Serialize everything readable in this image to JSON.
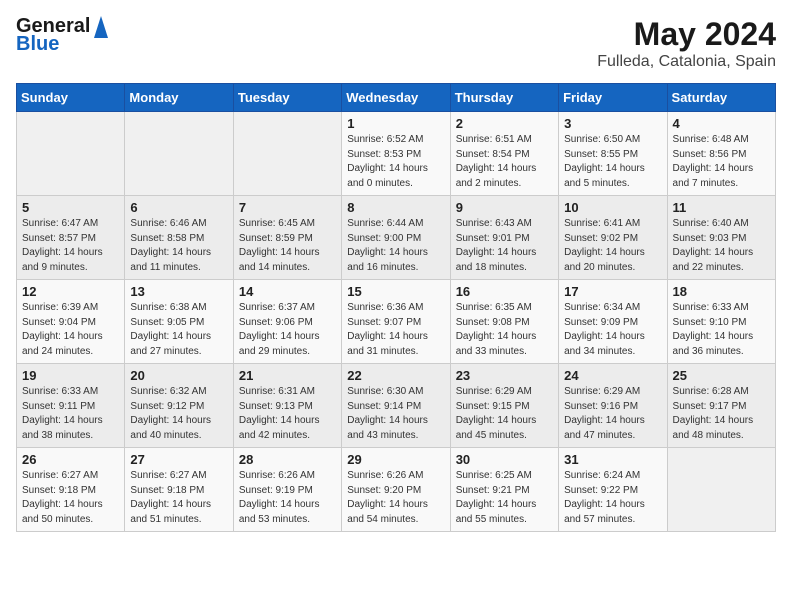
{
  "header": {
    "logo_general": "General",
    "logo_blue": "Blue",
    "title": "May 2024",
    "subtitle": "Fulleda, Catalonia, Spain"
  },
  "days_of_week": [
    "Sunday",
    "Monday",
    "Tuesday",
    "Wednesday",
    "Thursday",
    "Friday",
    "Saturday"
  ],
  "weeks": [
    [
      {
        "day": "",
        "info": ""
      },
      {
        "day": "",
        "info": ""
      },
      {
        "day": "",
        "info": ""
      },
      {
        "day": "1",
        "info": "Sunrise: 6:52 AM\nSunset: 8:53 PM\nDaylight: 14 hours\nand 0 minutes."
      },
      {
        "day": "2",
        "info": "Sunrise: 6:51 AM\nSunset: 8:54 PM\nDaylight: 14 hours\nand 2 minutes."
      },
      {
        "day": "3",
        "info": "Sunrise: 6:50 AM\nSunset: 8:55 PM\nDaylight: 14 hours\nand 5 minutes."
      },
      {
        "day": "4",
        "info": "Sunrise: 6:48 AM\nSunset: 8:56 PM\nDaylight: 14 hours\nand 7 minutes."
      }
    ],
    [
      {
        "day": "5",
        "info": "Sunrise: 6:47 AM\nSunset: 8:57 PM\nDaylight: 14 hours\nand 9 minutes."
      },
      {
        "day": "6",
        "info": "Sunrise: 6:46 AM\nSunset: 8:58 PM\nDaylight: 14 hours\nand 11 minutes."
      },
      {
        "day": "7",
        "info": "Sunrise: 6:45 AM\nSunset: 8:59 PM\nDaylight: 14 hours\nand 14 minutes."
      },
      {
        "day": "8",
        "info": "Sunrise: 6:44 AM\nSunset: 9:00 PM\nDaylight: 14 hours\nand 16 minutes."
      },
      {
        "day": "9",
        "info": "Sunrise: 6:43 AM\nSunset: 9:01 PM\nDaylight: 14 hours\nand 18 minutes."
      },
      {
        "day": "10",
        "info": "Sunrise: 6:41 AM\nSunset: 9:02 PM\nDaylight: 14 hours\nand 20 minutes."
      },
      {
        "day": "11",
        "info": "Sunrise: 6:40 AM\nSunset: 9:03 PM\nDaylight: 14 hours\nand 22 minutes."
      }
    ],
    [
      {
        "day": "12",
        "info": "Sunrise: 6:39 AM\nSunset: 9:04 PM\nDaylight: 14 hours\nand 24 minutes."
      },
      {
        "day": "13",
        "info": "Sunrise: 6:38 AM\nSunset: 9:05 PM\nDaylight: 14 hours\nand 27 minutes."
      },
      {
        "day": "14",
        "info": "Sunrise: 6:37 AM\nSunset: 9:06 PM\nDaylight: 14 hours\nand 29 minutes."
      },
      {
        "day": "15",
        "info": "Sunrise: 6:36 AM\nSunset: 9:07 PM\nDaylight: 14 hours\nand 31 minutes."
      },
      {
        "day": "16",
        "info": "Sunrise: 6:35 AM\nSunset: 9:08 PM\nDaylight: 14 hours\nand 33 minutes."
      },
      {
        "day": "17",
        "info": "Sunrise: 6:34 AM\nSunset: 9:09 PM\nDaylight: 14 hours\nand 34 minutes."
      },
      {
        "day": "18",
        "info": "Sunrise: 6:33 AM\nSunset: 9:10 PM\nDaylight: 14 hours\nand 36 minutes."
      }
    ],
    [
      {
        "day": "19",
        "info": "Sunrise: 6:33 AM\nSunset: 9:11 PM\nDaylight: 14 hours\nand 38 minutes."
      },
      {
        "day": "20",
        "info": "Sunrise: 6:32 AM\nSunset: 9:12 PM\nDaylight: 14 hours\nand 40 minutes."
      },
      {
        "day": "21",
        "info": "Sunrise: 6:31 AM\nSunset: 9:13 PM\nDaylight: 14 hours\nand 42 minutes."
      },
      {
        "day": "22",
        "info": "Sunrise: 6:30 AM\nSunset: 9:14 PM\nDaylight: 14 hours\nand 43 minutes."
      },
      {
        "day": "23",
        "info": "Sunrise: 6:29 AM\nSunset: 9:15 PM\nDaylight: 14 hours\nand 45 minutes."
      },
      {
        "day": "24",
        "info": "Sunrise: 6:29 AM\nSunset: 9:16 PM\nDaylight: 14 hours\nand 47 minutes."
      },
      {
        "day": "25",
        "info": "Sunrise: 6:28 AM\nSunset: 9:17 PM\nDaylight: 14 hours\nand 48 minutes."
      }
    ],
    [
      {
        "day": "26",
        "info": "Sunrise: 6:27 AM\nSunset: 9:18 PM\nDaylight: 14 hours\nand 50 minutes."
      },
      {
        "day": "27",
        "info": "Sunrise: 6:27 AM\nSunset: 9:18 PM\nDaylight: 14 hours\nand 51 minutes."
      },
      {
        "day": "28",
        "info": "Sunrise: 6:26 AM\nSunset: 9:19 PM\nDaylight: 14 hours\nand 53 minutes."
      },
      {
        "day": "29",
        "info": "Sunrise: 6:26 AM\nSunset: 9:20 PM\nDaylight: 14 hours\nand 54 minutes."
      },
      {
        "day": "30",
        "info": "Sunrise: 6:25 AM\nSunset: 9:21 PM\nDaylight: 14 hours\nand 55 minutes."
      },
      {
        "day": "31",
        "info": "Sunrise: 6:24 AM\nSunset: 9:22 PM\nDaylight: 14 hours\nand 57 minutes."
      },
      {
        "day": "",
        "info": ""
      }
    ]
  ]
}
